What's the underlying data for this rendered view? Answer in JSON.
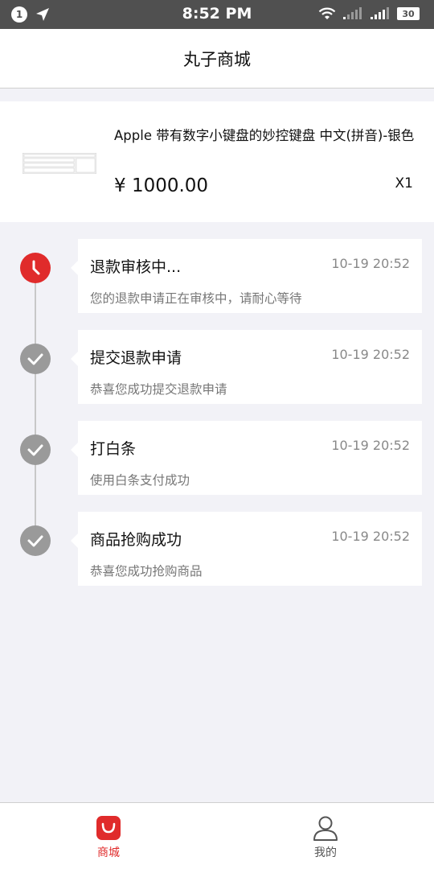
{
  "status_bar": {
    "notification_count": "1",
    "time": "8:52 PM",
    "battery": "30"
  },
  "nav": {
    "title": "丸子商城"
  },
  "product": {
    "name": "Apple 带有数字小键盘的妙控键盘 中文(拼音)-银色",
    "price": "¥ 1000.00",
    "quantity": "X1",
    "thumb_icon": "keyboard-image"
  },
  "timeline": [
    {
      "title": "退款审核中...",
      "time": "10-19 20:52",
      "desc": "您的退款申请正在审核中，请耐心等待",
      "status": "active",
      "icon": "clock-icon"
    },
    {
      "title": "提交退款申请",
      "time": "10-19 20:52",
      "desc": "恭喜您成功提交退款申请",
      "status": "done",
      "icon": "check-icon"
    },
    {
      "title": "打白条",
      "time": "10-19 20:52",
      "desc": "使用白条支付成功",
      "status": "done",
      "icon": "check-icon"
    },
    {
      "title": "商品抢购成功",
      "time": "10-19 20:52",
      "desc": "恭喜您成功抢购商品",
      "status": "done",
      "icon": "check-icon"
    }
  ],
  "tabs": [
    {
      "label": "商城",
      "icon": "shopping-bag-icon",
      "active": true
    },
    {
      "label": "我的",
      "icon": "user-icon",
      "active": false
    }
  ],
  "colors": {
    "accent": "#e02b2b",
    "done": "#9a9a9a",
    "status_bar": "#505050"
  }
}
